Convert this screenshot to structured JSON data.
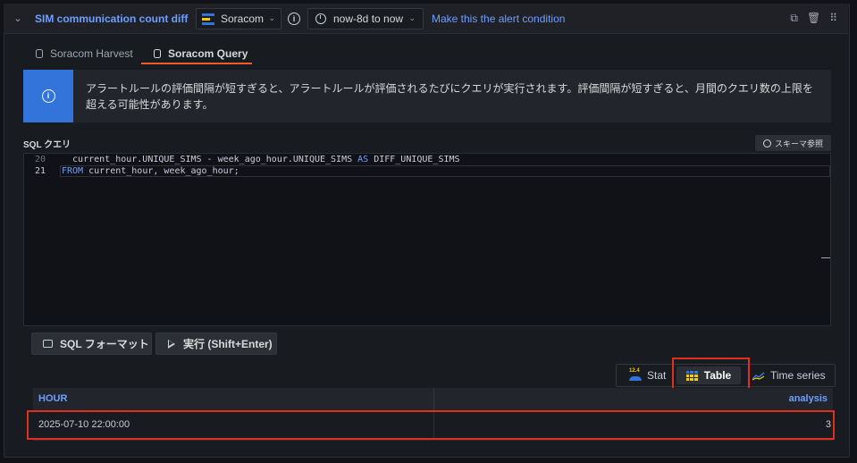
{
  "query": {
    "name": "SIM communication count diff",
    "datasource": "Soracom",
    "time_range": "now-8d to now",
    "alert_link": "Make this the alert condition"
  },
  "tabs": [
    {
      "label": "Soracom Harvest",
      "active": false
    },
    {
      "label": "Soracom Query",
      "active": true
    }
  ],
  "alert": {
    "message": "アラートルールの評価間隔が短すぎると、アラートルールが評価されるたびにクエリが実行されます。評価間隔が短すぎると、月間のクエリ数の上限を超える可能性があります。",
    "color": "#3274d9"
  },
  "sql": {
    "label": "SQL クエリ",
    "schema_button": "スキーマ参照",
    "lines": [
      {
        "number": "20",
        "code_pre": "  current_hour.UNIQUE_SIMS - week_ago_hour.UNIQUE_SIMS ",
        "keyword": "AS",
        "code_post": " DIFF_UNIQUE_SIMS"
      },
      {
        "number": "21",
        "code_pre": "",
        "keyword": "FROM",
        "code_post": " current_hour, week_ago_hour;"
      }
    ]
  },
  "actions": {
    "format_label": "SQL フォーマット",
    "run_label": "実行 (Shift+Enter)"
  },
  "visualization": {
    "options": [
      "Stat",
      "Table",
      "Time series"
    ],
    "selected": "Table",
    "stat_icon_text": "12.4"
  },
  "result": {
    "columns": [
      "HOUR",
      "analysis"
    ],
    "rows": [
      [
        "2025-07-10 22:00:00",
        "3"
      ]
    ]
  },
  "colors": {
    "accent_link": "#6e9fff",
    "tab_underline": "#f05a28",
    "highlight": "#e02f1f"
  }
}
